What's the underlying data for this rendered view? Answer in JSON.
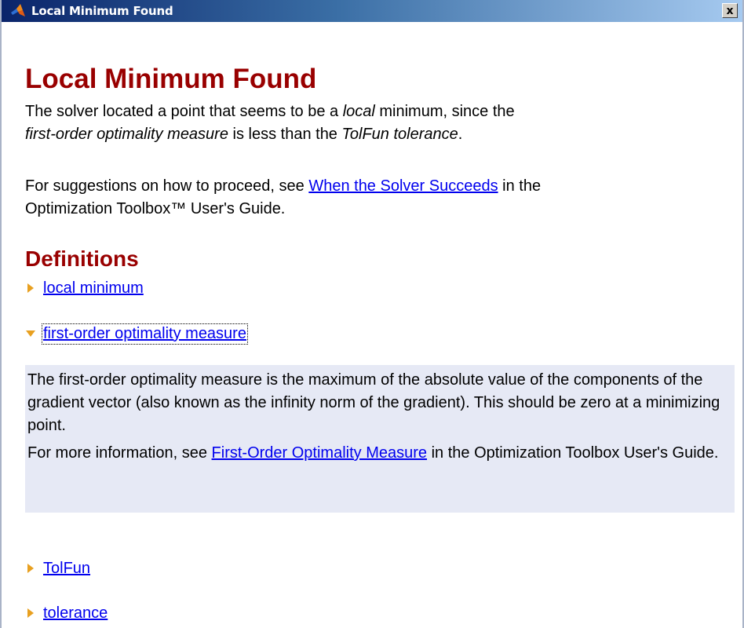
{
  "window": {
    "title": "Local Minimum Found",
    "close_label": "x"
  },
  "main": {
    "title": "Local Minimum Found",
    "para1": {
      "t1": "The solver located a point that seems to be a ",
      "t1_em": "local",
      "t2": " minimum, since the",
      "t3_em": "first-order optimality measure",
      "t4": " is less than the ",
      "t5_em": "TolFun tolerance",
      "t6": "."
    },
    "para2": {
      "t1": "For suggestions on how to proceed, see ",
      "link": "When the Solver Succeeds",
      "t2": " in the",
      "t3": "Optimization Toolbox™ User's Guide."
    }
  },
  "definitions": {
    "title": "Definitions",
    "items": [
      {
        "label": "local minimum",
        "expanded": false
      },
      {
        "label": "first-order optimality measure",
        "expanded": true
      },
      {
        "label": "TolFun",
        "expanded": false
      },
      {
        "label": "tolerance",
        "expanded": false
      }
    ],
    "expanded_body": {
      "p1": "The first-order optimality measure is the maximum of the absolute value of the components of the gradient vector (also known as the infinity norm of the gradient). This should be zero at a minimizing point.",
      "p2_t1": "For more information, see ",
      "p2_link": "First-Order Optimality Measure",
      "p2_t2": " in the Optimization Toolbox User's Guide."
    }
  },
  "colors": {
    "heading": "#990000",
    "link": "#0000ee",
    "expanded_bg": "#e6e9f5",
    "arrow": "#e8a020"
  },
  "icons": {
    "title_icon": "matlab-logo-icon",
    "collapsed_arrow": "triangle-right-icon",
    "expanded_arrow": "triangle-down-icon"
  }
}
